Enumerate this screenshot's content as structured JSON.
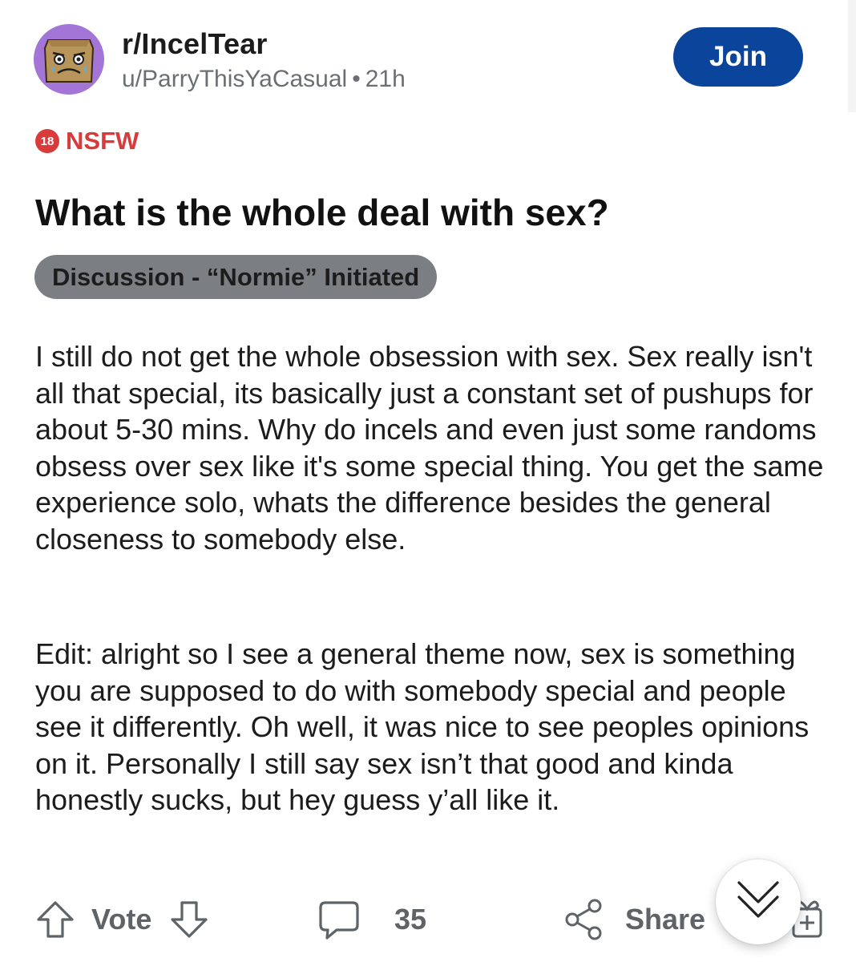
{
  "post": {
    "subreddit": "r/IncelTear",
    "author": "u/ParryThisYaCasual",
    "separator": "•",
    "age": "21h",
    "join_label": "Join",
    "nsfw_badge": "18",
    "nsfw_label": "NSFW",
    "title": "What is the whole deal with sex?",
    "flair": "Discussion - “Normie” Initiated",
    "body_paragraphs": [
      "I still do not get the whole obsession with sex. Sex really isn't all that special, its basically just a constant set of pushups for about 5-30 mins. Why do incels and even just some randoms obsess over sex like it's some special thing. You get the same experience solo, whats the difference besides the general closeness to somebody else.",
      "Edit: alright so I see a general theme now, sex is something you are supposed to do with somebody special and people see it differently. Oh well, it was nice to see peoples opinions on it. Personally I still say sex isn’t that good and kinda honestly sucks, but hey guess y’all like it."
    ]
  },
  "actions": {
    "vote_label": "Vote",
    "comment_count": "35",
    "share_label": "Share"
  },
  "icons": {
    "upvote": "arrow-up-icon",
    "downvote": "arrow-down-icon",
    "comment": "comment-bubble-icon",
    "share": "share-nodes-icon",
    "award": "award-icon",
    "scroll": "double-chevron-down-icon"
  },
  "colors": {
    "join_button": "#0a449b",
    "avatar_bg": "#a275d6",
    "nsfw": "#d93a3a",
    "flair_bg": "#7b7f83",
    "meta_text": "#6b6f73",
    "action_text": "#5e6368"
  }
}
